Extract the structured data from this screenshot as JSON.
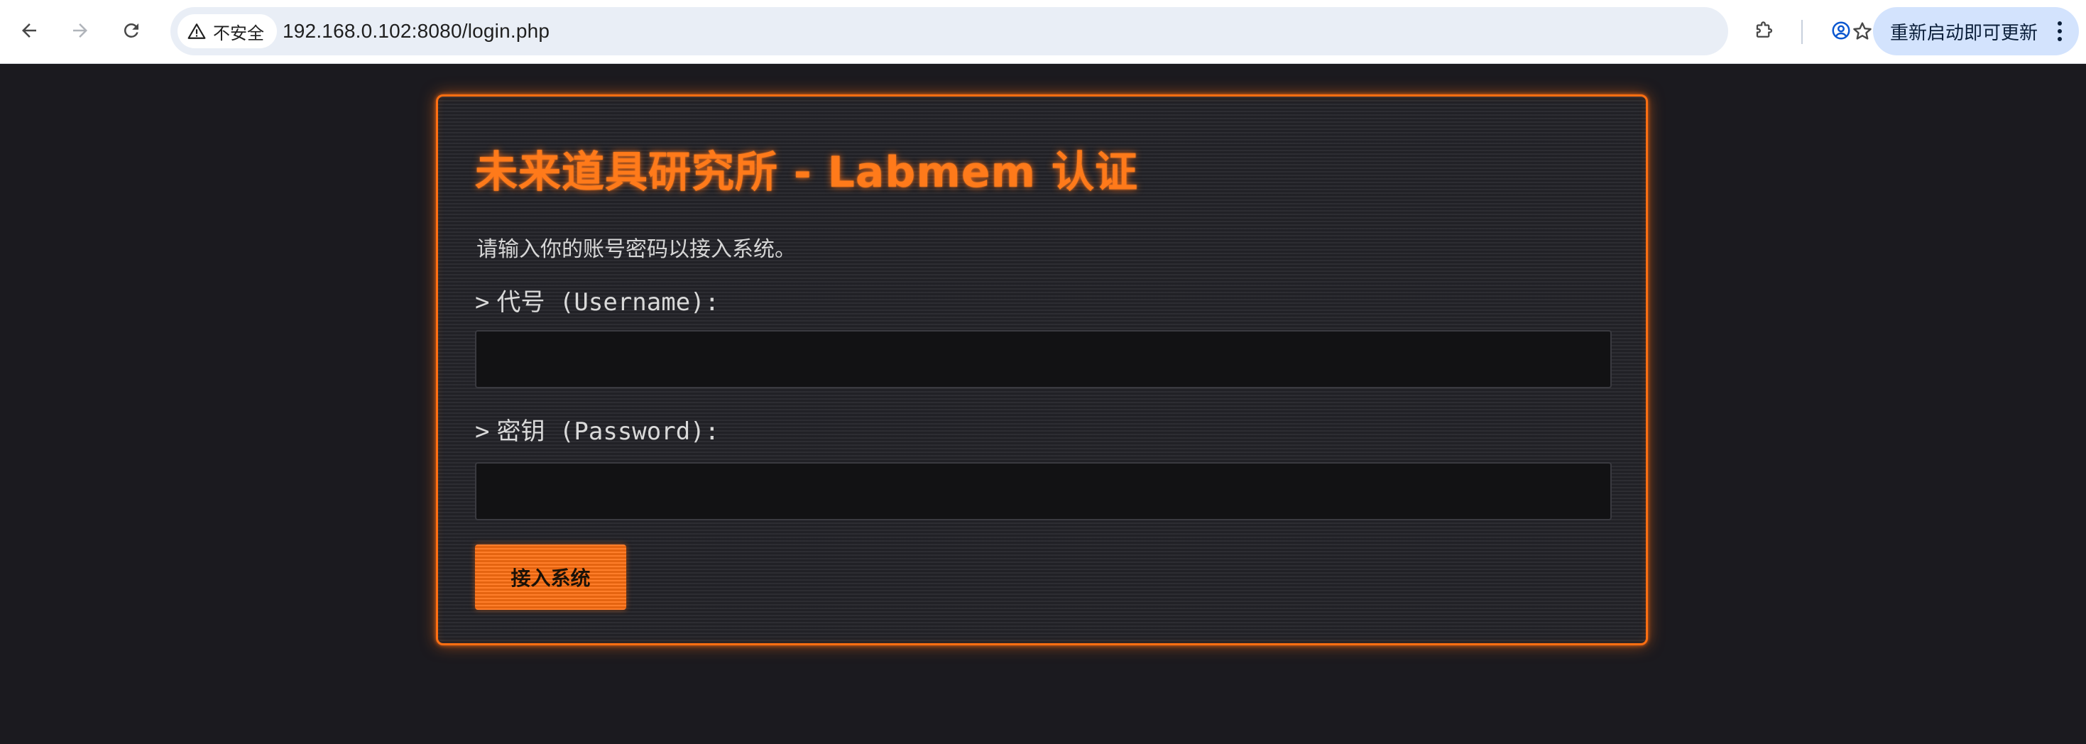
{
  "browser": {
    "security_chip_label": "不安全",
    "url": "192.168.0.102:8080/login.php",
    "update_button_label": "重新启动即可更新",
    "icons": {
      "back": "arrow-left",
      "forward": "arrow-right",
      "reload": "reload",
      "warning": "warning-triangle",
      "bookmark": "star-outline",
      "extensions": "puzzle-piece",
      "profile": "account-circle",
      "menu": "more-vertical"
    }
  },
  "login": {
    "title": "未来道具研究所 - Labmem 认证",
    "description": "请输入你的账号密码以接入系统。",
    "username_prompt": ">",
    "username_label": "代号 (Username):",
    "username_value": "",
    "password_prompt": ">",
    "password_label": "密钥 (Password):",
    "password_value": "",
    "submit_label": "接入系统"
  },
  "colors": {
    "accent": "#ff6f12",
    "page_background": "#1b1a1f",
    "panel_background": "#25252a",
    "input_background": "#121214",
    "omnibox_background": "#e9eef6",
    "update_button_background": "#d3e3fd"
  }
}
